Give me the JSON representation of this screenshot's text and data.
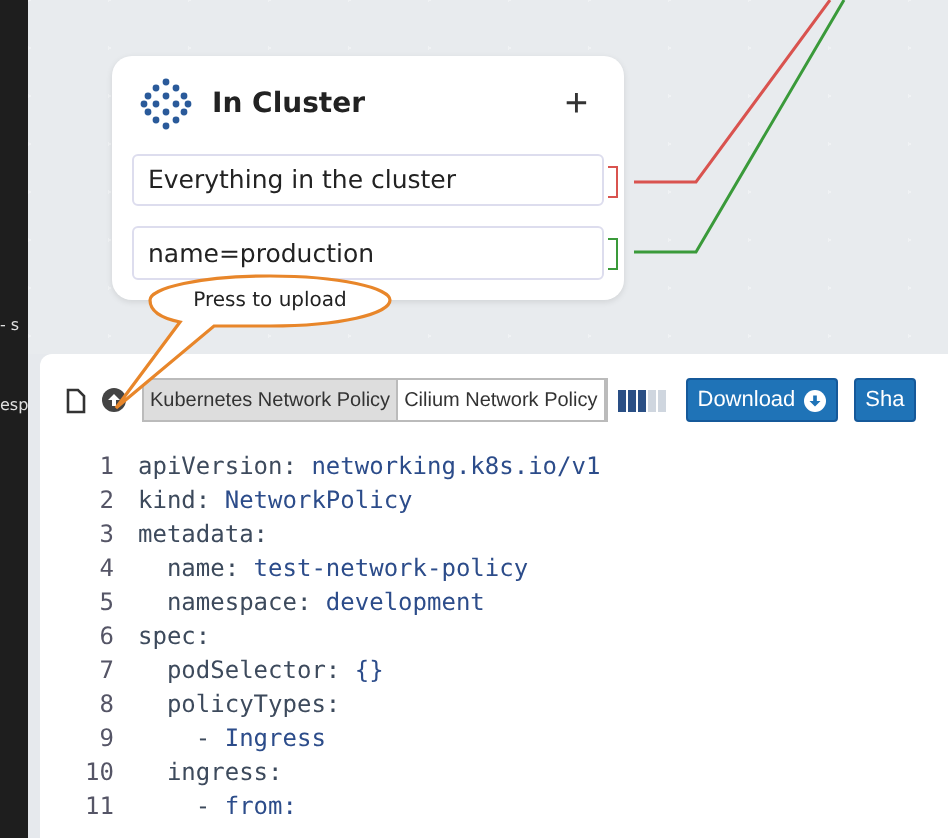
{
  "side_fragments": [
    "- s",
    "esp"
  ],
  "card": {
    "title": "In Cluster",
    "add": "+",
    "fields": [
      {
        "value": "Everything in the cluster",
        "color": "#d9534f"
      },
      {
        "value": "name=production",
        "color": "#3a9a3a"
      }
    ]
  },
  "callout": {
    "text": "Press to upload"
  },
  "toolbar": {
    "tabs": [
      {
        "label": "Kubernetes Network Policy",
        "selected": true
      },
      {
        "label": "Cilium Network Policy",
        "selected": false
      }
    ],
    "meter": {
      "level": 0.6
    },
    "buttons": [
      {
        "label": "Download",
        "kind": "download"
      },
      {
        "label": "Sha",
        "kind": "plain"
      }
    ]
  },
  "code": [
    {
      "num": "1",
      "key": "apiVersion:",
      "value": "networking.k8s.io/v1"
    },
    {
      "num": "2",
      "key": "kind:",
      "value": "NetworkPolicy"
    },
    {
      "num": "3",
      "key": "metadata:"
    },
    {
      "num": "4",
      "key": "  name:",
      "value": "test-network-policy"
    },
    {
      "num": "5",
      "key": "  namespace:",
      "value": "development"
    },
    {
      "num": "6",
      "key": "spec:"
    },
    {
      "num": "7",
      "key": "  podSelector:",
      "value": "{}"
    },
    {
      "num": "8",
      "key": "  policyTypes:"
    },
    {
      "num": "9",
      "key": "    -",
      "value": "Ingress"
    },
    {
      "num": "10",
      "key": "  ingress:"
    },
    {
      "num": "11",
      "key": "    -",
      "value": "from:"
    }
  ]
}
